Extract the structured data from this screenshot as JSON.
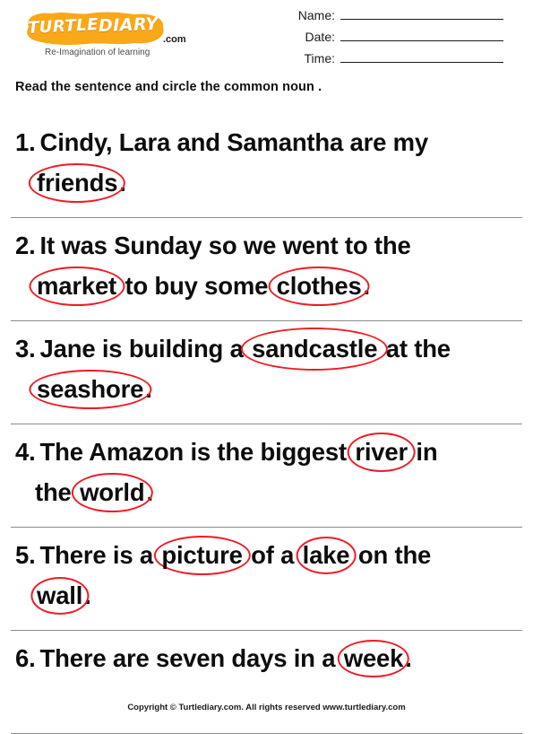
{
  "logo": {
    "word1": "TURTLE",
    "word2": "DIARY",
    "suffix": ".com",
    "tagline": "Re-Imagination of learning",
    "blob_color": "#F9A81A",
    "text_color": "#FFFFFF"
  },
  "header_fields": [
    {
      "label": "Name:"
    },
    {
      "label": "Date:"
    },
    {
      "label": "Time:"
    }
  ],
  "instruction": "Read the sentence and circle the common noun .",
  "answer_color": "#EE1C25",
  "questions": [
    {
      "number": "1.",
      "sentence": "Cindy, Lara and Samantha are my friends.",
      "answers": [
        "friends"
      ],
      "lines": [
        [
          {
            "text": "Cindy, Lara and Samantha are my",
            "circled": false
          }
        ],
        [
          {
            "text": "friends",
            "circled": true
          },
          {
            "text": ".",
            "circled": false
          }
        ]
      ]
    },
    {
      "number": "2.",
      "sentence": "It was Sunday so we went to the market to buy some clothes.",
      "answers": [
        "market",
        "clothes"
      ],
      "lines": [
        [
          {
            "text": "It was Sunday so we went to the",
            "circled": false
          }
        ],
        [
          {
            "text": "market",
            "circled": true
          },
          {
            "text": " to buy some ",
            "circled": false
          },
          {
            "text": "clothes",
            "circled": true
          },
          {
            "text": ".",
            "circled": false
          }
        ]
      ]
    },
    {
      "number": "3.",
      "sentence": "Jane is building a sandcastle at the seashore.",
      "answers": [
        "sandcastle",
        "seashore"
      ],
      "lines": [
        [
          {
            "text": "Jane is building a ",
            "circled": false
          },
          {
            "text": "sandcastle",
            "circled": true
          },
          {
            "text": " at the",
            "circled": false
          }
        ],
        [
          {
            "text": "seashore",
            "circled": true
          },
          {
            "text": ".",
            "circled": false
          }
        ]
      ]
    },
    {
      "number": "4.",
      "sentence": "The Amazon is the biggest river in the world.",
      "answers": [
        "river",
        "world"
      ],
      "lines": [
        [
          {
            "text": "The Amazon is the biggest ",
            "circled": false
          },
          {
            "text": "river",
            "circled": true
          },
          {
            "text": " in",
            "circled": false
          }
        ],
        [
          {
            "text": "the ",
            "circled": false
          },
          {
            "text": "world",
            "circled": true
          },
          {
            "text": ".",
            "circled": false
          }
        ]
      ]
    },
    {
      "number": "5.",
      "sentence": "There is a picture of a lake on the wall.",
      "answers": [
        "picture",
        "lake",
        "wall"
      ],
      "lines": [
        [
          {
            "text": "There is a ",
            "circled": false
          },
          {
            "text": "picture",
            "circled": true
          },
          {
            "text": " of a ",
            "circled": false
          },
          {
            "text": "lake",
            "circled": true
          },
          {
            "text": " on the",
            "circled": false
          }
        ],
        [
          {
            "text": "wall",
            "circled": true
          },
          {
            "text": ".",
            "circled": false
          }
        ]
      ]
    },
    {
      "number": "6.",
      "sentence": "There are seven days in a week.",
      "answers": [
        "week"
      ],
      "lines": [
        [
          {
            "text": "There are seven days in a ",
            "circled": false
          },
          {
            "text": "week",
            "circled": true
          },
          {
            "text": ".",
            "circled": false
          }
        ]
      ]
    }
  ],
  "footer": "Copyright © Turtlediary.com. All rights reserved  www.turtlediary.com"
}
